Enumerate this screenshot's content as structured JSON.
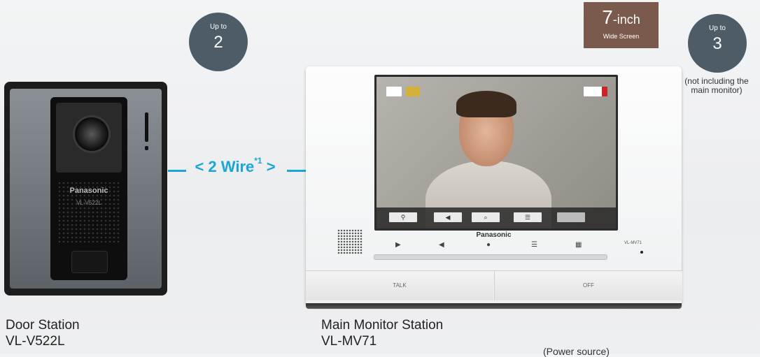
{
  "badges": {
    "door": {
      "small": "Up to",
      "num": "2"
    },
    "monitor": {
      "small": "Up to",
      "num": "3"
    },
    "screen": {
      "size": "7",
      "unit": "-inch",
      "sub": "Wide Screen"
    },
    "monitor_note": "(not including the main monitor)"
  },
  "wire": {
    "label": "2 Wire",
    "footnote": "*1"
  },
  "door_station": {
    "brand": "Panasonic",
    "model_plate": "VL-V522L",
    "title": "Door Station",
    "model": "VL-V522L"
  },
  "main_monitor": {
    "brand": "Panasonic",
    "model_plate": "VL-MV71",
    "talk_label": "TALK",
    "off_label": "OFF",
    "title": "Main Monitor Station",
    "model": "VL-MV71"
  },
  "power_source": "(Power source)",
  "colors": {
    "badge": "#4d5c66",
    "screen_badge": "#7a5a4c",
    "wire": "#1aa6d6"
  }
}
